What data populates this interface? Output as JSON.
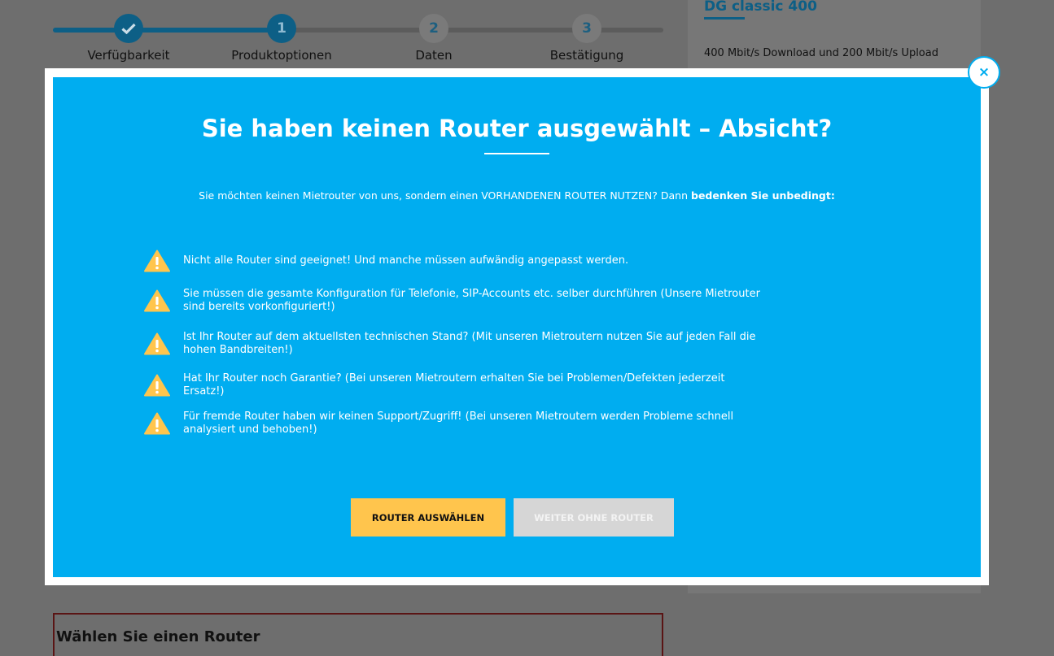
{
  "stepper": {
    "steps": [
      {
        "label": "Verfügbarkeit",
        "marker": "check-icon"
      },
      {
        "label": "Produktoptionen",
        "number": "1"
      },
      {
        "label": "Daten",
        "number": "2"
      },
      {
        "label": "Bestätigung",
        "number": "3"
      }
    ]
  },
  "sidebar": {
    "title": "DG classic 400",
    "description": "400 Mbit/s Download und 200 Mbit/s Upload"
  },
  "router_section": {
    "heading": "Wählen Sie einen Router"
  },
  "modal": {
    "title": "Sie haben keinen Router ausgewählt – Absicht?",
    "intro_text": "Sie möchten keinen Mietrouter von uns, sondern einen VORHANDENEN ROUTER NUTZEN? Dann",
    "intro_bold": "bedenken Sie unbedingt:",
    "warnings": [
      "Nicht alle Router sind geeignet! Und manche müssen aufwändig angepasst werden.",
      "Sie müssen die gesamte Konfiguration für Telefonie, SIP-Accounts etc. selber durchführen (Unsere Mietrouter sind bereits vorkonfiguriert!)",
      "Ist Ihr Router auf dem aktuellsten technischen Stand? (Mit unseren Mietroutern nutzen Sie auf jeden Fall die hohen Bandbreiten!)",
      "Hat Ihr Router noch Garantie? (Bei unseren Mietroutern erhalten Sie bei Problemen/Defekten jederzeit Ersatz!)",
      "Für fremde Router haben wir keinen Support/Zugriff! (Bei unseren Mietroutern werden Probleme schnell analysiert und behoben!)"
    ],
    "primary_button": "Router auswählen",
    "secondary_button": "Weiter ohne Router",
    "close_label": "×"
  },
  "colors": {
    "modal_bg": "#00adf0",
    "warning_icon": "#ffc54d",
    "primary_button": "#ffc54d",
    "secondary_button": "#d6d6d6"
  }
}
